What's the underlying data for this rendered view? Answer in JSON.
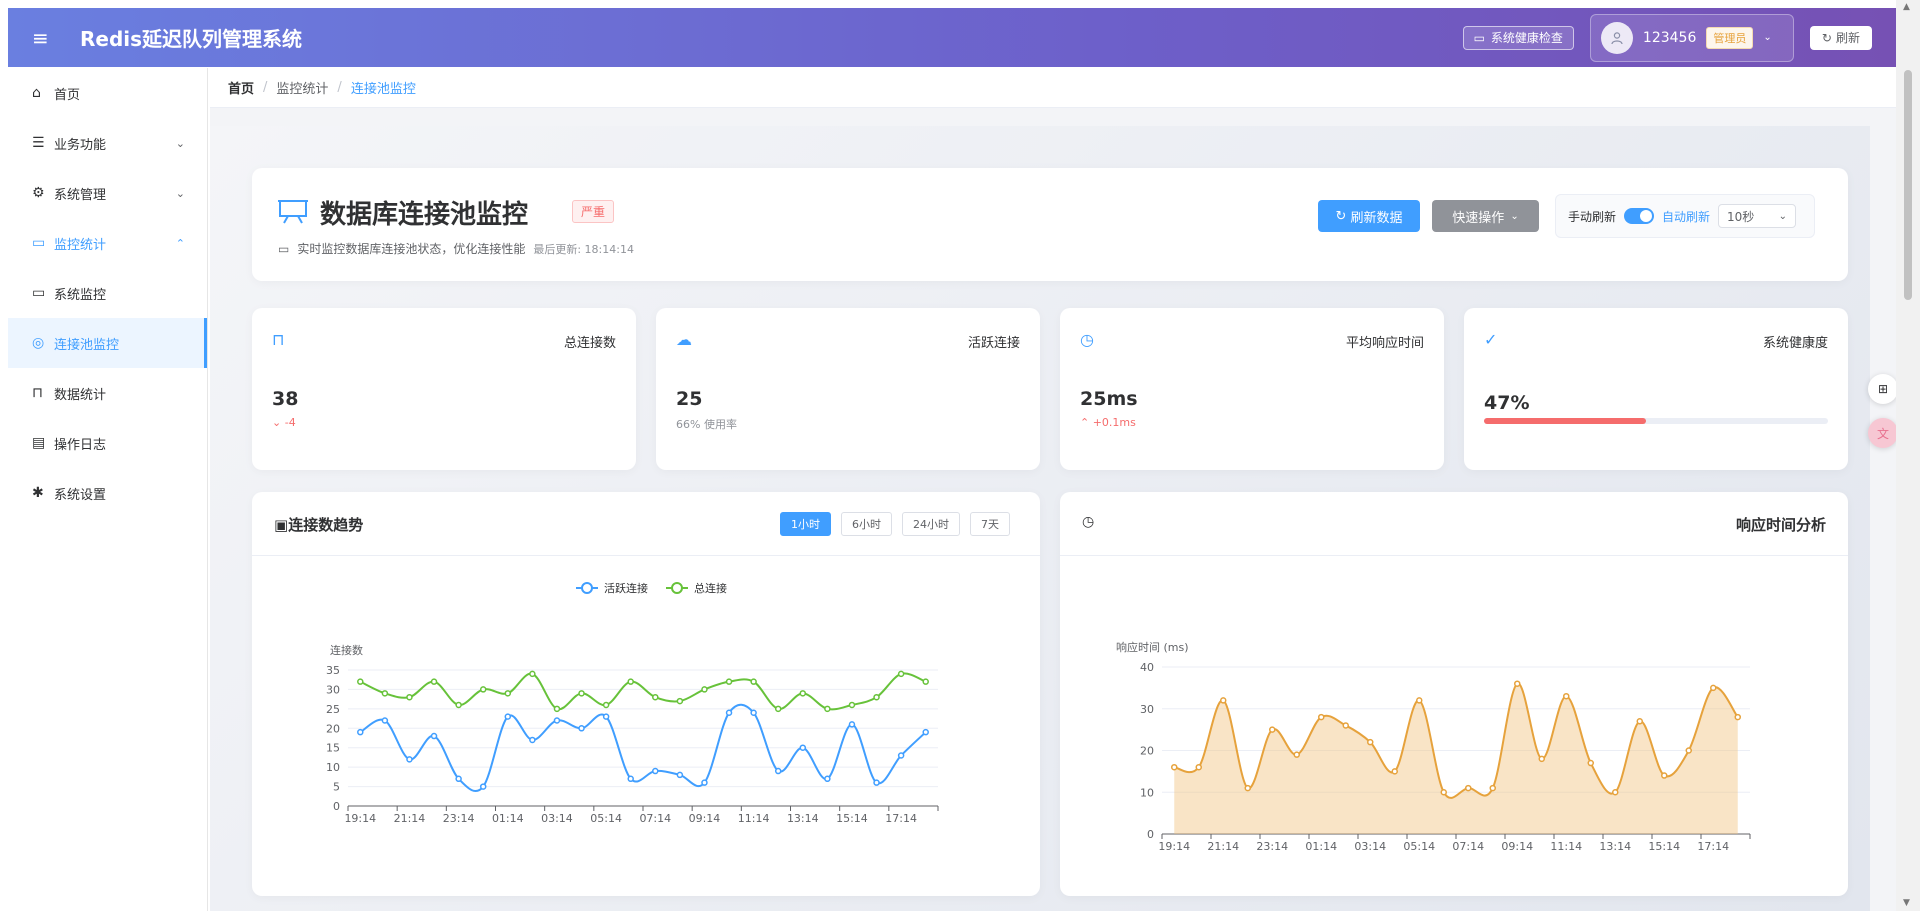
{
  "header": {
    "title": "Redis延迟队列管理系统",
    "health_check": "系统健康检查",
    "username": "123456",
    "role": "管理员",
    "refresh": "刷新"
  },
  "sidebar": {
    "items": [
      {
        "label": "首页",
        "icon": "home-icon"
      },
      {
        "label": "业务功能",
        "icon": "sliders-icon"
      },
      {
        "label": "系统管理",
        "icon": "gear-icon"
      },
      {
        "label": "监控统计",
        "icon": "monitor-icon"
      },
      {
        "label": "系统监控",
        "icon": "monitor-icon"
      },
      {
        "label": "连接池监控",
        "icon": "connection-icon"
      },
      {
        "label": "数据统计",
        "icon": "presentation-icon"
      },
      {
        "label": "操作日志",
        "icon": "document-icon"
      },
      {
        "label": "系统设置",
        "icon": "cog-icon"
      }
    ]
  },
  "breadcrumb": [
    "首页",
    "监控统计",
    "连接池监控"
  ],
  "title_card": {
    "title": "数据库连接池监控",
    "badge": "严重",
    "subtitle": "实时监控数据库连接池状态，优化连接性能",
    "last_update": "最后更新: 18:14:14",
    "refresh_btn": "刷新数据",
    "quick_btn": "快速操作",
    "manual_refresh": "手动刷新",
    "auto_refresh": "自动刷新",
    "interval": "10秒"
  },
  "stats": [
    {
      "label": "总连接数",
      "value": "38",
      "trend": "-4"
    },
    {
      "label": "活跃连接",
      "value": "25",
      "sub": "66% 使用率"
    },
    {
      "label": "平均响应时间",
      "value": "25ms",
      "trend": "+0.1ms"
    },
    {
      "label": "系统健康度",
      "value": "47%",
      "progress": 0.47
    }
  ],
  "conn_chart": {
    "title": "连接数趋势",
    "ranges": [
      "1小时",
      "6小时",
      "24小时",
      "7天"
    ],
    "active_range": "1小时"
  },
  "resp_chart": {
    "title": "响应时间分析"
  },
  "colors": {
    "primary": "#409eff",
    "active_series": "#409eff",
    "total_series": "#67c23a",
    "response_series": "#e6a23c",
    "danger": "#f56c6c"
  },
  "chart_data": [
    {
      "type": "line",
      "ylabel": "连接数",
      "ylim": [
        0,
        35
      ],
      "yticks": [
        0,
        5,
        10,
        15,
        20,
        25,
        30,
        35
      ],
      "xtick_labels": [
        "19:14",
        "21:14",
        "23:14",
        "01:14",
        "03:14",
        "05:14",
        "07:14",
        "09:14",
        "11:14",
        "13:14",
        "15:14",
        "17:14"
      ],
      "legend": [
        "活跃连接",
        "总连接"
      ],
      "series": [
        {
          "name": "活跃连接",
          "values": [
            19,
            22,
            12,
            18,
            7,
            5,
            23,
            17,
            22,
            20,
            23,
            7,
            9,
            8,
            6,
            24,
            24,
            9,
            15,
            7,
            21,
            6,
            13,
            19
          ]
        },
        {
          "name": "总连接",
          "values": [
            32,
            29,
            28,
            32,
            26,
            30,
            29,
            34,
            25,
            29,
            26,
            32,
            28,
            27,
            30,
            32,
            32,
            25,
            29,
            25,
            26,
            28,
            34,
            32
          ]
        }
      ]
    },
    {
      "type": "area",
      "ylabel": "响应时间 (ms)",
      "ylim": [
        0,
        40
      ],
      "yticks": [
        0,
        10,
        20,
        30,
        40
      ],
      "xtick_labels": [
        "19:14",
        "21:14",
        "23:14",
        "01:14",
        "03:14",
        "05:14",
        "07:14",
        "09:14",
        "11:14",
        "13:14",
        "15:14",
        "17:14"
      ],
      "series": [
        {
          "name": "响应时间",
          "values": [
            16,
            16,
            32,
            11,
            25,
            19,
            28,
            26,
            22,
            15,
            32,
            10,
            11,
            11,
            36,
            18,
            33,
            17,
            10,
            27,
            14,
            20,
            35,
            28
          ]
        }
      ]
    }
  ]
}
